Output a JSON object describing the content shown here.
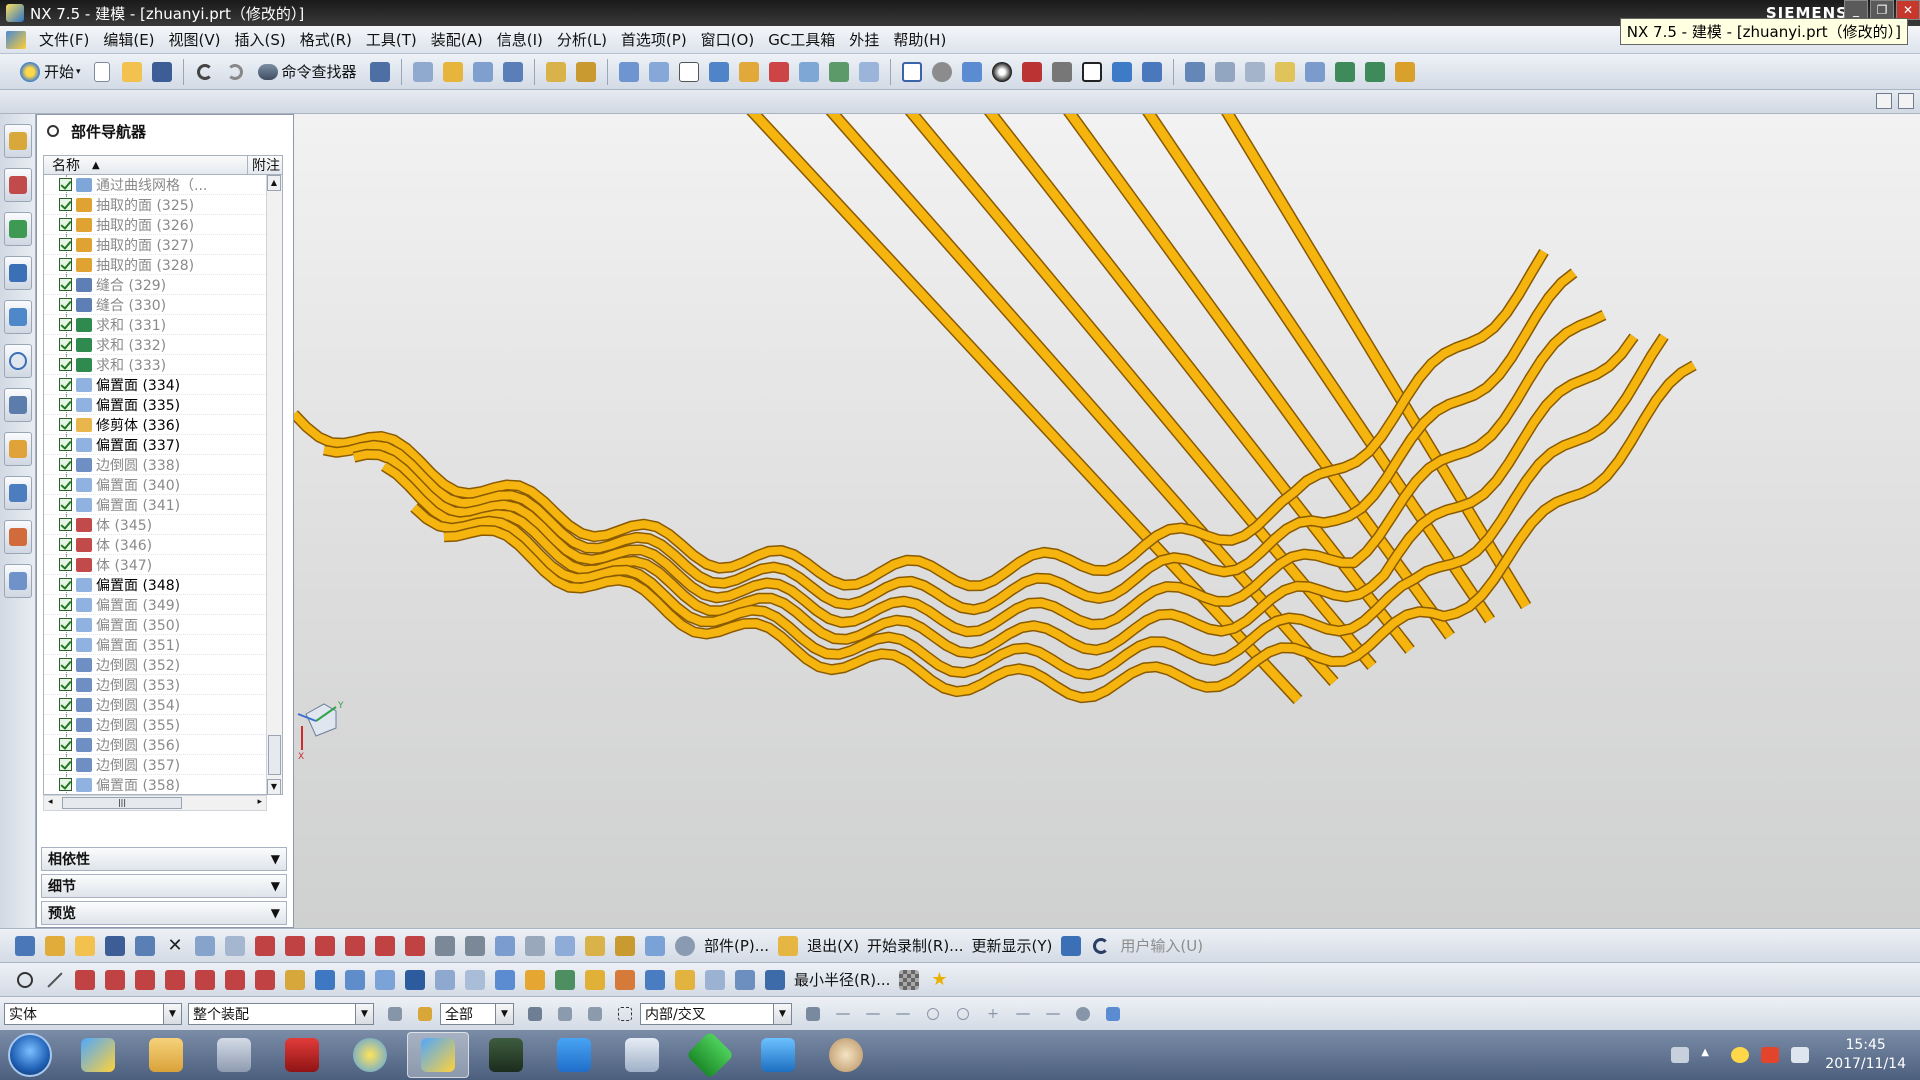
{
  "window": {
    "title": "NX 7.5 - 建模 - [zhuanyi.prt（修改的）]",
    "brand": "SIEMENS",
    "tooltip": "NX 7.5 - 建模 - [zhuanyi.prt（修改的）]"
  },
  "menu": [
    "文件(F)",
    "编辑(E)",
    "视图(V)",
    "插入(S)",
    "格式(R)",
    "工具(T)",
    "装配(A)",
    "信息(I)",
    "分析(L)",
    "首选项(P)",
    "窗口(O)",
    "GC工具箱",
    "外挂",
    "帮助(H)"
  ],
  "toolbar": {
    "start_label": "开始",
    "finder_label": "命令查找器"
  },
  "navigator": {
    "title": "部件导航器",
    "col_name": "名称",
    "col_note": "附注",
    "rows": [
      {
        "label": "通过曲线网格（...",
        "style": "dim",
        "icon": "#7fa6d8"
      },
      {
        "label": "抽取的面 (325)",
        "style": "dim",
        "icon": "#e0a230"
      },
      {
        "label": "抽取的面 (326)",
        "style": "dim",
        "icon": "#e0a230"
      },
      {
        "label": "抽取的面 (327)",
        "style": "dim",
        "icon": "#e0a230"
      },
      {
        "label": "抽取的面 (328)",
        "style": "dim",
        "icon": "#e0a230"
      },
      {
        "label": "缝合 (329)",
        "style": "dim",
        "icon": "#5e7fb6"
      },
      {
        "label": "缝合 (330)",
        "style": "dim",
        "icon": "#5e7fb6"
      },
      {
        "label": "求和 (331)",
        "style": "dim",
        "icon": "#2f8a4f"
      },
      {
        "label": "求和 (332)",
        "style": "dim",
        "icon": "#2f8a4f"
      },
      {
        "label": "求和 (333)",
        "style": "dim",
        "icon": "#2f8a4f"
      },
      {
        "label": "偏置面 (334)",
        "style": "bold",
        "icon": "#8fb2e0"
      },
      {
        "label": "偏置面 (335)",
        "style": "bold",
        "icon": "#8fb2e0"
      },
      {
        "label": "修剪体 (336)",
        "style": "bold",
        "icon": "#e8b64a"
      },
      {
        "label": "偏置面 (337)",
        "style": "bold",
        "icon": "#8fb2e0"
      },
      {
        "label": "边倒圆 (338)",
        "style": "dim",
        "icon": "#6f8fc4"
      },
      {
        "label": "偏置面 (340)",
        "style": "dim",
        "icon": "#8fb2e0"
      },
      {
        "label": "偏置面 (341)",
        "style": "dim",
        "icon": "#8fb2e0"
      },
      {
        "label": "体 (345)",
        "style": "dim",
        "icon": "#c24a4a"
      },
      {
        "label": "体 (346)",
        "style": "dim",
        "icon": "#c24a4a"
      },
      {
        "label": "体 (347)",
        "style": "dim",
        "icon": "#c24a4a"
      },
      {
        "label": "偏置面 (348)",
        "style": "bold",
        "icon": "#8fb2e0"
      },
      {
        "label": "偏置面 (349)",
        "style": "dim",
        "icon": "#8fb2e0"
      },
      {
        "label": "偏置面 (350)",
        "style": "dim",
        "icon": "#8fb2e0"
      },
      {
        "label": "偏置面 (351)",
        "style": "dim",
        "icon": "#8fb2e0"
      },
      {
        "label": "边倒圆 (352)",
        "style": "dim",
        "icon": "#6f8fc4"
      },
      {
        "label": "边倒圆 (353)",
        "style": "dim",
        "icon": "#6f8fc4"
      },
      {
        "label": "边倒圆 (354)",
        "style": "dim",
        "icon": "#6f8fc4"
      },
      {
        "label": "边倒圆 (355)",
        "style": "dim",
        "icon": "#6f8fc4"
      },
      {
        "label": "边倒圆 (356)",
        "style": "dim",
        "icon": "#6f8fc4"
      },
      {
        "label": "边倒圆 (357)",
        "style": "dim",
        "icon": "#6f8fc4"
      },
      {
        "label": "偏置面 (358)",
        "style": "dim",
        "icon": "#8fb2e0"
      }
    ],
    "sections": [
      "相依性",
      "细节",
      "预览"
    ]
  },
  "bottom_toolbar1": {
    "part_label": "部件(P)...",
    "exit_label": "退出(X)",
    "record_label": "开始录制(R)...",
    "refresh_label": "更新显示(Y)",
    "user_input_label": "用户输入(U)"
  },
  "bottom_toolbar2": {
    "min_radius_label": "最小半径(R)..."
  },
  "selection_bar": {
    "filter_type": "实体",
    "scope": "整个装配",
    "snap_all": "全部",
    "intersect": "内部/交叉"
  },
  "taskbar": {
    "time": "15:45",
    "date": "2017/11/14"
  },
  "colors": {
    "wire": "#f5b40e",
    "wire_edge": "#8a5a00",
    "accent": "#1f5fb5"
  }
}
